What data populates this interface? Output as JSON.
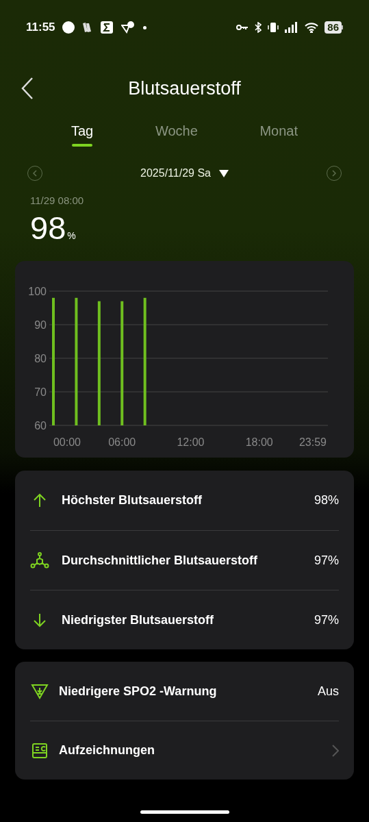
{
  "status_bar": {
    "time": "11:55",
    "battery": "86"
  },
  "header": {
    "title": "Blutsauerstoff"
  },
  "tabs": [
    {
      "label": "Tag",
      "selected": true
    },
    {
      "label": "Woche",
      "selected": false
    },
    {
      "label": "Monat",
      "selected": false
    }
  ],
  "date_nav": {
    "date": "2025/11/29 Sa"
  },
  "reading": {
    "time": "11/29 08:00",
    "value": "98",
    "unit": "%"
  },
  "chart": {
    "chart_data": {
      "type": "bar",
      "x": [
        0,
        2,
        4,
        6,
        8
      ],
      "series": [
        {
          "color": "#6fbf1f",
          "values": [
            98,
            98,
            97,
            97,
            98
          ]
        }
      ],
      "xlim": [
        0,
        24
      ],
      "ylim": [
        60,
        100
      ],
      "xticks": [
        {
          "value": 0,
          "label": "00:00"
        },
        {
          "value": 6,
          "label": "06:00"
        },
        {
          "value": 12,
          "label": "12:00"
        },
        {
          "value": 18,
          "label": "18:00"
        },
        {
          "value": 23.98,
          "label": "23:59"
        }
      ],
      "yticks": [
        60,
        70,
        80,
        90,
        100
      ],
      "grid": true
    }
  },
  "stats": [
    {
      "kind": "up",
      "label": "Höchster Blutsauerstoff",
      "value": "98%"
    },
    {
      "kind": "average",
      "label": "Durchschnittlicher Blutsauerstoff",
      "value": "97%"
    },
    {
      "kind": "down",
      "label": "Niedrigster Blutsauerstoff",
      "value": "97%"
    }
  ],
  "settings": [
    {
      "kind": "warning",
      "label": "Niedrigere SPO2 -Warnung",
      "value": "Aus"
    },
    {
      "kind": "records",
      "label": "Aufzeichnungen"
    }
  ]
}
